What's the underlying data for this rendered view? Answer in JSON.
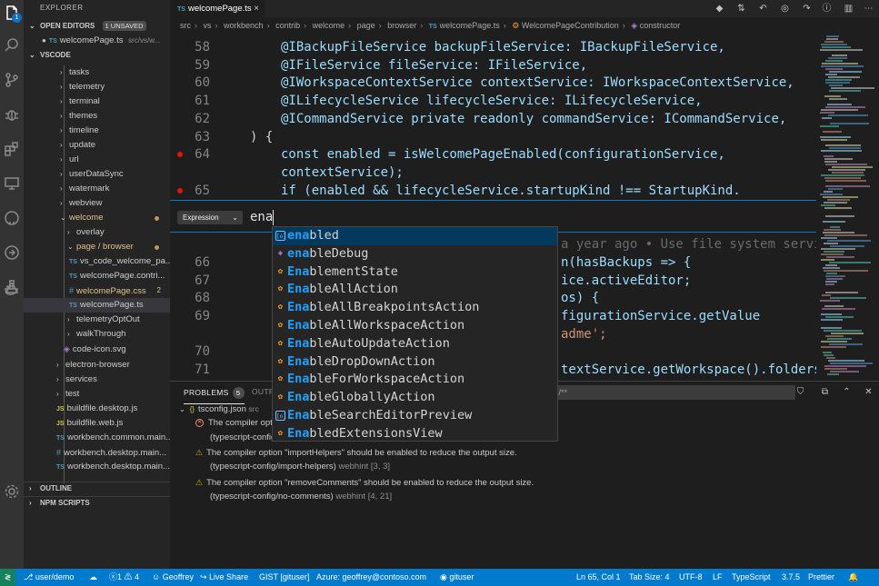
{
  "activity_bar": {
    "badge": "1",
    "icons": [
      "files-icon",
      "search-icon",
      "source-control-icon",
      "debug-icon",
      "extensions-icon",
      "remote-explorer-icon",
      "github-icon",
      "live-share-icon",
      "test-icon",
      "docker-icon",
      "settings-gear-icon"
    ]
  },
  "sidebar": {
    "title": "EXPLORER",
    "open_editors": {
      "label": "OPEN EDITORS",
      "badge": "1 UNSAVED"
    },
    "open_file": {
      "name": "welcomePage.ts",
      "path": "src/vs/w..."
    },
    "workspace_label": "VSCODE",
    "tree": [
      {
        "label": "tasks"
      },
      {
        "label": "telemetry"
      },
      {
        "label": "terminal"
      },
      {
        "label": "themes"
      },
      {
        "label": "timeline"
      },
      {
        "label": "update"
      },
      {
        "label": "url"
      },
      {
        "label": "userDataSync"
      },
      {
        "label": "watermark"
      },
      {
        "label": "webview"
      },
      {
        "label": "welcome"
      },
      {
        "label": "overlay"
      },
      {
        "label": "page / browser"
      },
      {
        "label": "vs_code_welcome_pa..."
      },
      {
        "label": "welcomePage.contri..."
      },
      {
        "label": "welcomePage.css",
        "count": "2"
      },
      {
        "label": "welcomePage.ts"
      },
      {
        "label": "telemetryOptOut"
      },
      {
        "label": "walkThrough"
      },
      {
        "label": "code-icon.svg"
      },
      {
        "label": "electron-browser"
      },
      {
        "label": "services"
      },
      {
        "label": "test"
      },
      {
        "label": "buildfile.desktop.js"
      },
      {
        "label": "buildfile.web.js"
      },
      {
        "label": "workbench.common.main..."
      },
      {
        "label": "workbench.desktop.main..."
      },
      {
        "label": "workbench.desktop.main..."
      }
    ],
    "outline_label": "OUTLINE",
    "npm_label": "NPM SCRIPTS"
  },
  "tab": {
    "label": "welcomePage.ts",
    "close": "×"
  },
  "breadcrumb": [
    "src",
    "vs",
    "workbench",
    "contrib",
    "welcome",
    "page",
    "browser",
    "welcomePage.ts",
    "WelcomePageContribution",
    "constructor"
  ],
  "editor": {
    "line_numbers": [
      "58",
      "59",
      "60",
      "61",
      "62",
      "63",
      "64",
      "",
      "65",
      "66",
      "67",
      "68",
      "69",
      "",
      "70",
      "71"
    ],
    "lines_top": [
      "@IBackupFileService backupFileService: IBackupFileService,",
      "@IFileService fileService: IFileService,",
      "@IWorkspaceContextService contextService: IWorkspaceContextService,",
      "@ILifecycleService lifecycleService: ILifecycleService,",
      "@ICommandService private readonly commandService: ICommandService,",
      ") {",
      "const enabled = isWelcomePageEnabled(configurationService,",
      "contextService);",
      "if (enabled && lifecycleService.startupKind !== StartupKind."
    ],
    "ghost_blame": "a year ago • Use file system servic",
    "lines_partial": [
      "n(hasBackups => {",
      "ice.activeEditor;",
      "os) {",
      "figurationService.getValue",
      "adme';",
      "",
      "textService.getWorkspace().folders."
    ]
  },
  "expression": {
    "select_label": "Expression",
    "input_value": "ena"
  },
  "suggestions": [
    {
      "match": "ena",
      "rest": "bled",
      "kind": "variable"
    },
    {
      "match": "ena",
      "rest": "bleDebug",
      "kind": "module"
    },
    {
      "match": "Ena",
      "rest": "blementState",
      "kind": "class"
    },
    {
      "match": "Ena",
      "rest": "bleAllAction",
      "kind": "class"
    },
    {
      "match": "Ena",
      "rest": "bleAllBreakpointsAction",
      "kind": "class"
    },
    {
      "match": "Ena",
      "rest": "bleAllWorkspaceAction",
      "kind": "class"
    },
    {
      "match": "Ena",
      "rest": "bleAutoUpdateAction",
      "kind": "class"
    },
    {
      "match": "Ena",
      "rest": "bleDropDownAction",
      "kind": "class"
    },
    {
      "match": "Ena",
      "rest": "bleForWorkspaceAction",
      "kind": "class"
    },
    {
      "match": "Ena",
      "rest": "bleGloballyAction",
      "kind": "class"
    },
    {
      "match": "Ena",
      "rest": "bleSearchEditorPreview",
      "kind": "variable"
    },
    {
      "match": "Ena",
      "rest": "bledExtensionsView",
      "kind": "class"
    }
  ],
  "panel": {
    "tabs": [
      {
        "label": "PROBLEMS",
        "badge": "5"
      },
      {
        "label": "OUTP"
      }
    ],
    "filter_text": "s/**",
    "file": {
      "name": "tsconfig.json",
      "path": "src"
    },
    "problems": [
      {
        "type": "error",
        "text": "The compiler optio",
        "code": "(typescript-config"
      },
      {
        "type": "warning",
        "text": "The compiler option \"importHelpers\" should be enabled to reduce the output size.",
        "code": "(typescript-config/import-helpers)",
        "source": "webhint",
        "pos": "[3, 3]"
      },
      {
        "type": "warning",
        "text": "The compiler option \"removeComments\" should be enabled to reduce the output size.",
        "code": "(typescript-config/no-comments)",
        "source": "webhint",
        "pos": "[4, 21]"
      }
    ]
  },
  "status_bar": {
    "remote": "≷",
    "branch": "user/demo",
    "errors": "1",
    "warnings": "4",
    "user": "Geoffrey",
    "live_share": "Live Share",
    "gist": "GIST [gituser]",
    "azure": "Azure: geoffrey@contoso.com",
    "gituser": "gituser",
    "position": "Ln 65, Col 1",
    "tab_size": "Tab Size: 4",
    "encoding": "UTF-8",
    "eol": "LF",
    "language": "TypeScript",
    "ts_version": "3.7.5",
    "prettier": "Prettier"
  }
}
